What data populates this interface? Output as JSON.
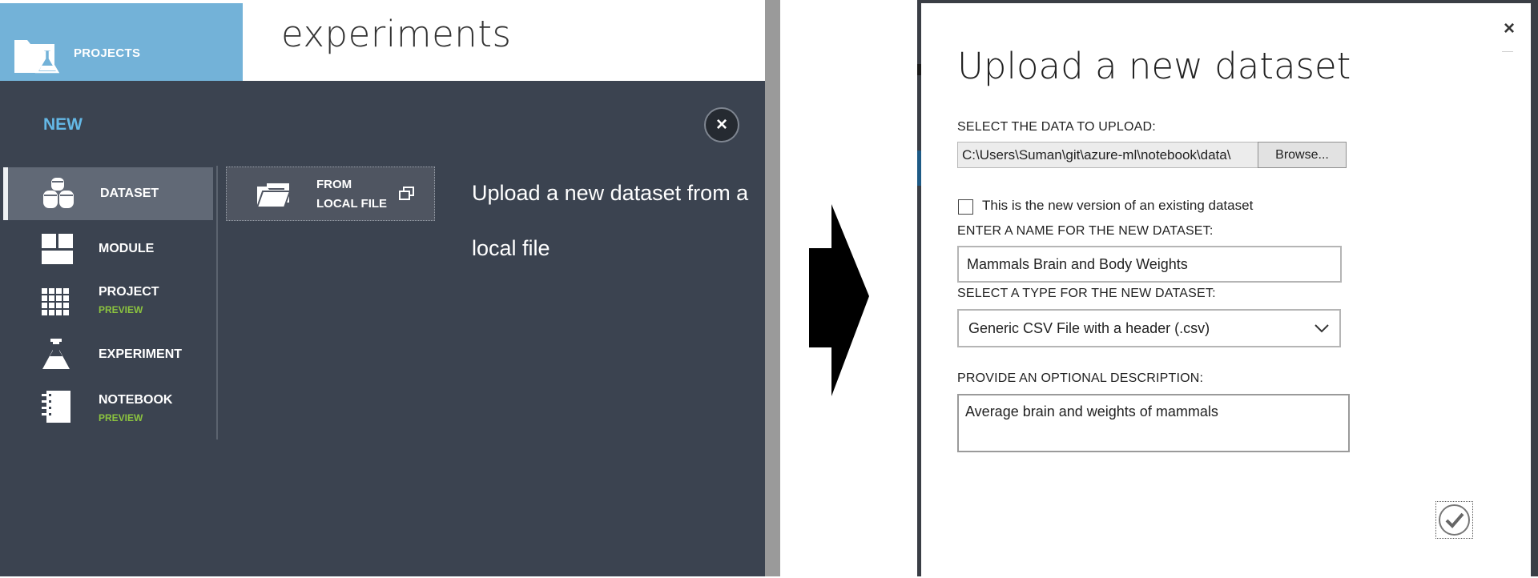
{
  "left_panel": {
    "projects_label": "PROJECTS",
    "page_heading": "experiments",
    "new_label": "NEW",
    "nav_items": [
      {
        "label": "DATASET",
        "badge": "",
        "icon": "dataset-icon",
        "active": true
      },
      {
        "label": "MODULE",
        "badge": "",
        "icon": "module-icon",
        "active": false
      },
      {
        "label": "PROJECT",
        "badge": "PREVIEW",
        "icon": "project-grid-icon",
        "active": false
      },
      {
        "label": "EXPERIMENT",
        "badge": "",
        "icon": "flask-icon",
        "active": false
      },
      {
        "label": "NOTEBOOK",
        "badge": "PREVIEW",
        "icon": "notebook-icon",
        "active": false
      }
    ],
    "sub_option": {
      "line1": "FROM",
      "line2": "LOCAL FILE",
      "icon": "open-folder-icon"
    },
    "description_line1": "Upload a new dataset from a",
    "description_line2": "local file",
    "close_icon": "×"
  },
  "dialog": {
    "title": "Upload a new dataset",
    "close_icon": "×",
    "select_data_label": "SELECT THE DATA TO UPLOAD:",
    "file_path": "C:\\Users\\Suman\\git\\azure-ml\\notebook\\data\\",
    "browse_label": "Browse...",
    "version_checkbox_label": "This is the new version of an existing dataset",
    "version_checked": false,
    "name_label": "ENTER A NAME FOR THE NEW DATASET:",
    "name_value": "Mammals Brain and Body Weights",
    "type_label": "SELECT A TYPE FOR THE NEW DATASET:",
    "type_value": "Generic CSV File with a header (.csv)",
    "description_label": "PROVIDE AN OPTIONAL DESCRIPTION:",
    "description_value": "Average brain and weights of mammals"
  },
  "colors": {
    "left_bg": "#3b4350",
    "projects_tile": "#73b2d8",
    "new_accent": "#64b8e6",
    "preview_green": "#8cc43f",
    "active_nav": "#616976"
  }
}
